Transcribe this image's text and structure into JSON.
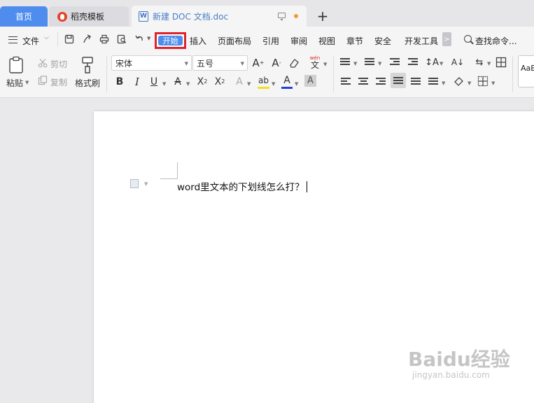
{
  "tabs": {
    "home": "首页",
    "template": "稻壳模板",
    "document": "新建 DOC 文档.doc",
    "new_tab": "+"
  },
  "doc_icon_letter": "W",
  "menu": {
    "file": "文件",
    "active_tab": "开始",
    "items": [
      "插入",
      "页面布局",
      "引用",
      "审阅",
      "视图",
      "章节",
      "安全",
      "开发工具"
    ],
    "more": ">",
    "search_placeholder": "查找命令..."
  },
  "ribbon": {
    "paste": "粘贴",
    "cut": "剪切",
    "copy": "复制",
    "format_painter": "格式刷",
    "font_name": "宋体",
    "font_size": "五号",
    "style_preview": "AaB",
    "phonetic_glyph": "wén",
    "phonetic_char": "文"
  },
  "colors": {
    "accent": "#4e8ded",
    "highlight_outline": "#e0232a",
    "highlighter_yellow": "#f5e11a",
    "font_color_red": "#e0232a",
    "doc_tab_text": "#4a7ec6"
  },
  "document": {
    "text": "word里文本的下划线怎么打？"
  },
  "watermark": {
    "logo": "Baidu经验",
    "url": "jingyan.baidu.com"
  }
}
